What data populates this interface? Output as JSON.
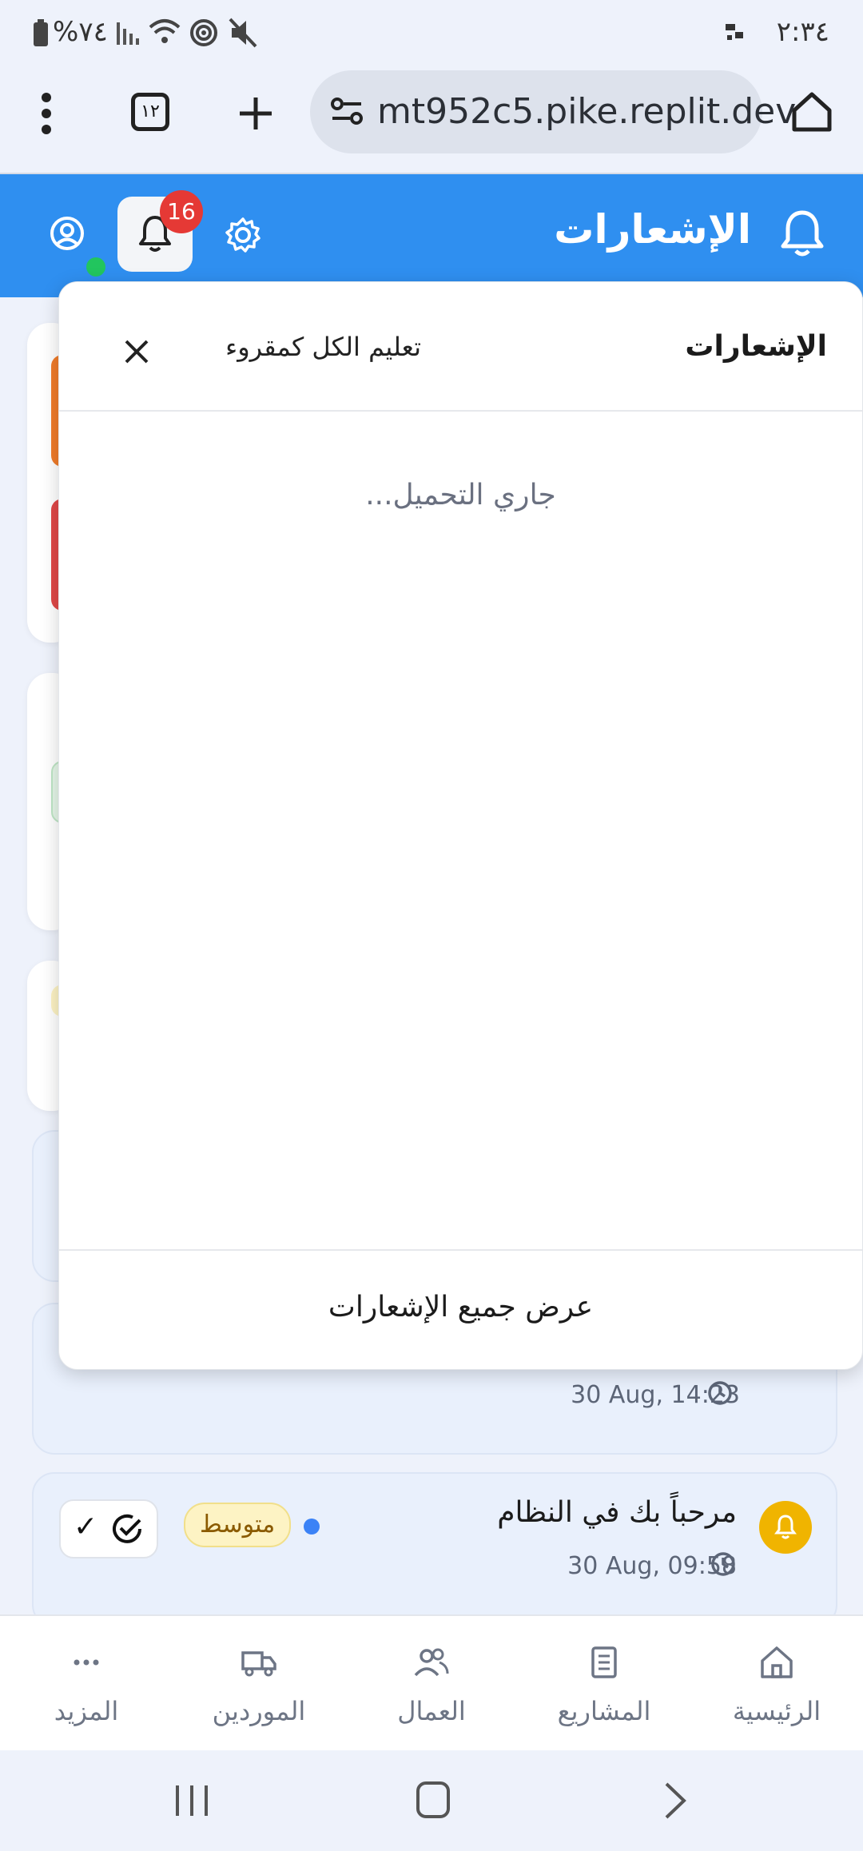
{
  "status_bar": {
    "time": "٢:٣٤",
    "battery": "%٧٤"
  },
  "browser": {
    "url": "mt952c5.pike.replit.dev",
    "tab_count": "١٢"
  },
  "header": {
    "title": "الإشعارات",
    "badge_count": "16"
  },
  "notifications_panel": {
    "title": "الإشعارات",
    "mark_all_read": "تعليم الكل كمقروء",
    "loading": "...جاري التحميل",
    "view_all": "عرض جميع الإشعارات"
  },
  "background_notifications": [
    {
      "title": "",
      "time": "30 Aug, 14:23"
    },
    {
      "title": "مرحباً بك في النظام",
      "priority": "متوسط",
      "time": "30 Aug, 09:58",
      "mark_read": "✓"
    }
  ],
  "bottom_nav": {
    "items": [
      {
        "label": "الرئيسية",
        "icon": "home-icon"
      },
      {
        "label": "المشاريع",
        "icon": "building-icon"
      },
      {
        "label": "العمال",
        "icon": "users-icon"
      },
      {
        "label": "الموردين",
        "icon": "truck-icon"
      },
      {
        "label": "المزيد",
        "icon": "more-icon"
      }
    ]
  },
  "colors": {
    "primary": "#2f8ff0",
    "badge": "#e53935",
    "priority_bg": "#fdf3c4",
    "bell_yellow": "#f0b400"
  }
}
